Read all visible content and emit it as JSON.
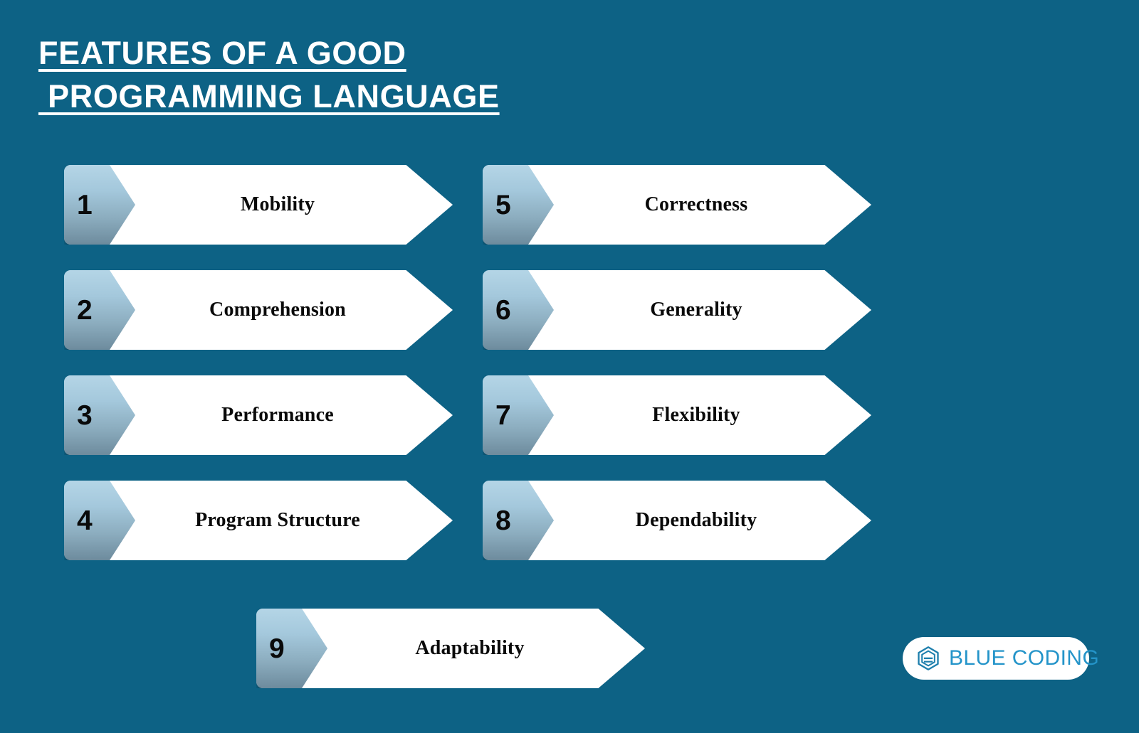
{
  "slide": {
    "background_color": "#0d6285",
    "title_lines": [
      "FEATURES OF A GOOD",
      " PROGRAMMING LANGUAGE"
    ],
    "title_color": "#ffffff"
  },
  "features": {
    "arrow_gradient_top": "#b4d5e6",
    "arrow_gradient_bottom": "#6d8b9d",
    "plate_color": "#ffffff",
    "text_color": "#0a0a0a",
    "items": [
      {
        "number": "1",
        "label": "Mobility"
      },
      {
        "number": "2",
        "label": "Comprehension"
      },
      {
        "number": "3",
        "label": "Performance"
      },
      {
        "number": "4",
        "label": "Program Structure"
      },
      {
        "number": "5",
        "label": "Correctness"
      },
      {
        "number": "6",
        "label": "Generality"
      },
      {
        "number": "7",
        "label": "Flexibility"
      },
      {
        "number": "8",
        "label": "Dependability"
      },
      {
        "number": "9",
        "label": "Adaptability"
      }
    ]
  },
  "logo": {
    "text": "BLUE CODING",
    "icon": "hexagon-b-icon",
    "text_color": "#2494c9",
    "pill_color": "#ffffff"
  }
}
